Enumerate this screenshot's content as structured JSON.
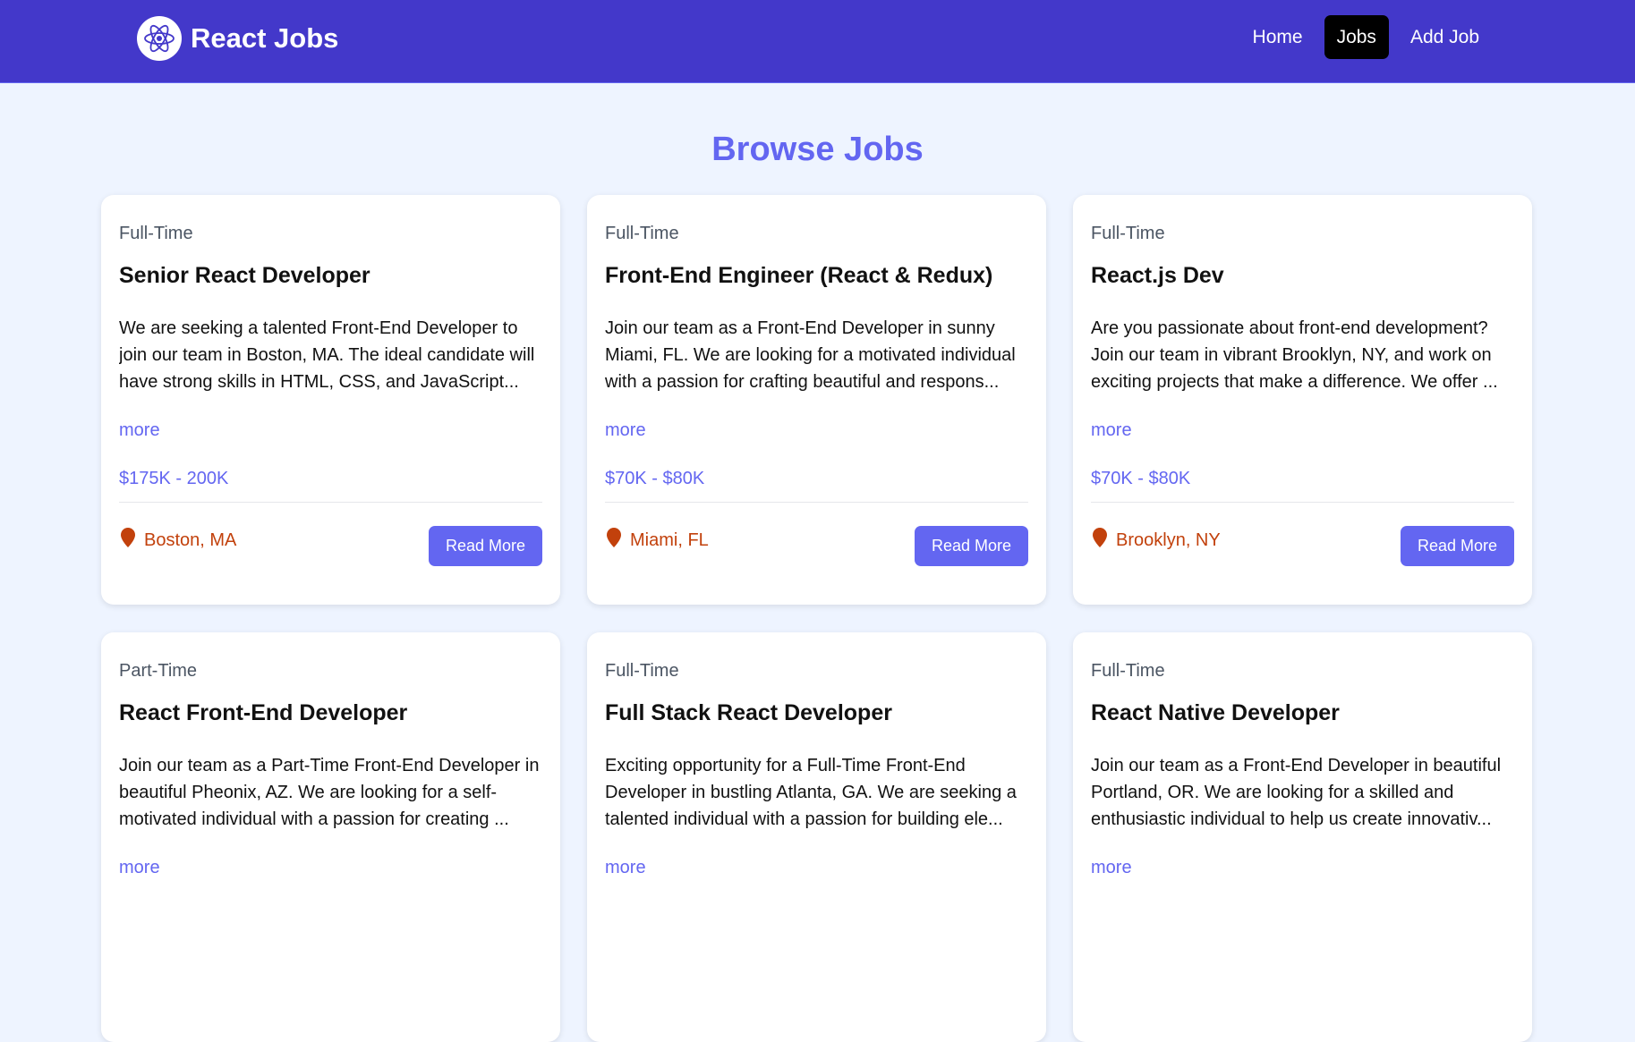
{
  "navbar": {
    "brand_name": "React Jobs",
    "links": [
      {
        "label": "Home",
        "active": false
      },
      {
        "label": "Jobs",
        "active": true
      },
      {
        "label": "Add Job",
        "active": false
      }
    ]
  },
  "page": {
    "title": "Browse Jobs"
  },
  "jobs": [
    {
      "type": "Full-Time",
      "title": "Senior React Developer",
      "description": "We are seeking a talented Front-End Developer to join our team in Boston, MA. The ideal candidate will have strong skills in HTML, CSS, and JavaScript...",
      "more_label": "more",
      "salary": "$175K - 200K",
      "location": "Boston, MA",
      "button_label": "Read More"
    },
    {
      "type": "Full-Time",
      "title": "Front-End Engineer (React & Redux)",
      "description": "Join our team as a Front-End Developer in sunny Miami, FL. We are looking for a motivated individual with a passion for crafting beautiful and respons...",
      "more_label": "more",
      "salary": "$70K - $80K",
      "location": "Miami, FL",
      "button_label": "Read More"
    },
    {
      "type": "Full-Time",
      "title": "React.js Dev",
      "description": "Are you passionate about front-end development? Join our team in vibrant Brooklyn, NY, and work on exciting projects that make a difference. We offer ...",
      "more_label": "more",
      "salary": "$70K - $80K",
      "location": "Brooklyn, NY",
      "button_label": "Read More"
    },
    {
      "type": "Part-Time",
      "title": "React Front-End Developer",
      "description": "Join our team as a Part-Time Front-End Developer in beautiful Pheonix, AZ. We are looking for a self-motivated individual with a passion for creating ...",
      "more_label": "more",
      "salary": "",
      "location": "",
      "button_label": ""
    },
    {
      "type": "Full-Time",
      "title": "Full Stack React Developer",
      "description": "Exciting opportunity for a Full-Time Front-End Developer in bustling Atlanta, GA. We are seeking a talented individual with a passion for building ele...",
      "more_label": "more",
      "salary": "",
      "location": "",
      "button_label": ""
    },
    {
      "type": "Full-Time",
      "title": "React Native Developer",
      "description": "Join our team as a Front-End Developer in beautiful Portland, OR. We are looking for a skilled and enthusiastic individual to help us create innovativ...",
      "more_label": "more",
      "salary": "",
      "location": "",
      "button_label": ""
    }
  ],
  "colors": {
    "navbar_bg": "#4338ca",
    "accent": "#6366f1",
    "active_link_bg": "#000000",
    "location": "#c2410c",
    "page_bg": "#eef4ff"
  },
  "icons": {
    "brand": "react-atom-icon",
    "location": "map-marker-icon"
  }
}
